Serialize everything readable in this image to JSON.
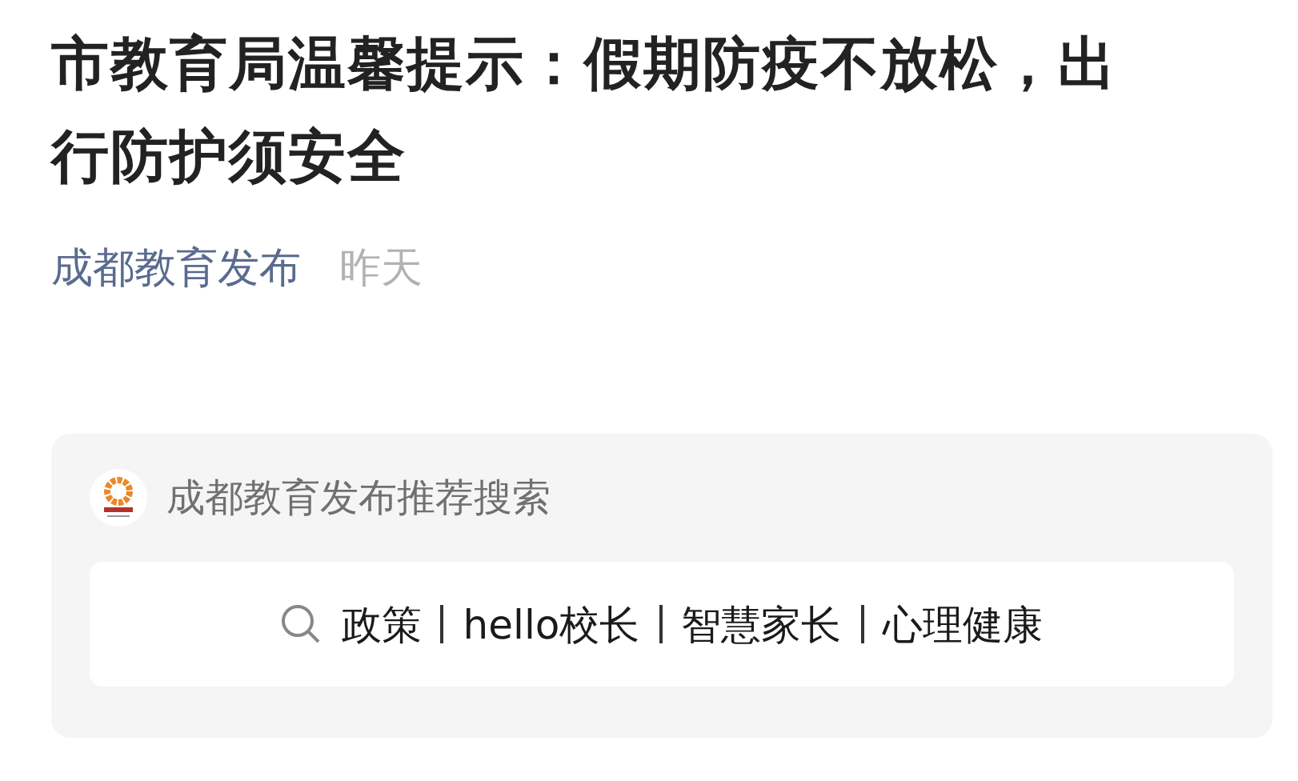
{
  "article": {
    "title": "市教育局温馨提示：假期防疫不放松，出行防护须安全",
    "author": "成都教育发布",
    "time": "昨天"
  },
  "recommend": {
    "account": "成都教育发布",
    "label": "推荐搜索",
    "terms": [
      "政策",
      "hello校长",
      "智慧家长",
      "心理健康"
    ]
  }
}
